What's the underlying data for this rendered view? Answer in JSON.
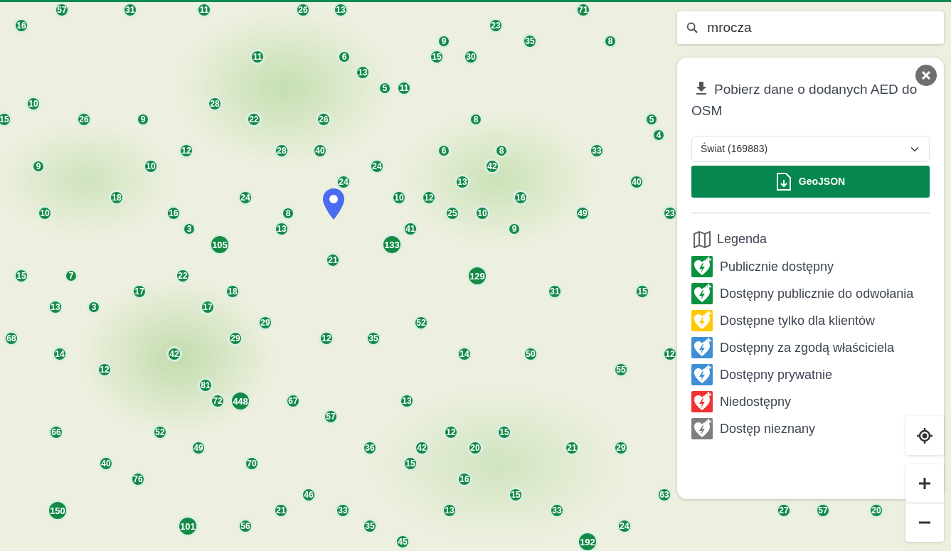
{
  "search": {
    "value": "mrocza"
  },
  "download_panel": {
    "title": "Pobierz dane o dodanych AED do OSM",
    "region_select": {
      "value": "Świat (169883)"
    },
    "button": "GeoJSON"
  },
  "legend": {
    "title": "Legenda",
    "items": [
      {
        "label": "Publicznie dostępny",
        "color": "#0a9140"
      },
      {
        "label": "Dostępny publicznie do odwołania",
        "color": "#0a9140"
      },
      {
        "label": "Dostępne tylko dla klientów",
        "color": "#ffc800"
      },
      {
        "label": "Dostępny za zgodą właściciela",
        "color": "#3f8fd6"
      },
      {
        "label": "Dostępny prywatnie",
        "color": "#3f8fd6"
      },
      {
        "label": "Niedostępny",
        "color": "#f03232"
      },
      {
        "label": "Dostęp nieznany",
        "color": "#7f7f7f"
      }
    ]
  },
  "clusters": [
    {
      "count": "57"
    },
    {
      "count": "31"
    },
    {
      "count": "11"
    },
    {
      "count": "26"
    },
    {
      "count": "13"
    },
    {
      "count": "71"
    },
    {
      "count": "16"
    },
    {
      "count": "23"
    },
    {
      "count": "9"
    },
    {
      "count": "35"
    },
    {
      "count": "8"
    },
    {
      "count": "11"
    },
    {
      "count": "6"
    },
    {
      "count": "15"
    },
    {
      "count": "30"
    },
    {
      "count": "13"
    },
    {
      "count": "5"
    },
    {
      "count": "11"
    },
    {
      "count": "10"
    },
    {
      "count": "28"
    },
    {
      "count": "15"
    },
    {
      "count": "26"
    },
    {
      "count": "9"
    },
    {
      "count": "22"
    },
    {
      "count": "26"
    },
    {
      "count": "8"
    },
    {
      "count": "5"
    },
    {
      "count": "4"
    },
    {
      "count": "12"
    },
    {
      "count": "28"
    },
    {
      "count": "40"
    },
    {
      "count": "6"
    },
    {
      "count": "8"
    },
    {
      "count": "33"
    },
    {
      "count": "9"
    },
    {
      "count": "10"
    },
    {
      "count": "24"
    },
    {
      "count": "42"
    },
    {
      "count": "24"
    },
    {
      "count": "13"
    },
    {
      "count": "40"
    },
    {
      "count": "18"
    },
    {
      "count": "24"
    },
    {
      "count": "10"
    },
    {
      "count": "12"
    },
    {
      "count": "16"
    },
    {
      "count": "10"
    },
    {
      "count": "16"
    },
    {
      "count": "8"
    },
    {
      "count": "25"
    },
    {
      "count": "10"
    },
    {
      "count": "49"
    },
    {
      "count": "23"
    },
    {
      "count": "3"
    },
    {
      "count": "13"
    },
    {
      "count": "41"
    },
    {
      "count": "9"
    },
    {
      "count": "105"
    },
    {
      "count": "133"
    },
    {
      "count": "21"
    },
    {
      "count": "15"
    },
    {
      "count": "7"
    },
    {
      "count": "22"
    },
    {
      "count": "129"
    },
    {
      "count": "17"
    },
    {
      "count": "18"
    },
    {
      "count": "31"
    },
    {
      "count": "15"
    },
    {
      "count": "13"
    },
    {
      "count": "3"
    },
    {
      "count": "17"
    },
    {
      "count": "29"
    },
    {
      "count": "52"
    },
    {
      "count": "68"
    },
    {
      "count": "29"
    },
    {
      "count": "12"
    },
    {
      "count": "35"
    },
    {
      "count": "14"
    },
    {
      "count": "42"
    },
    {
      "count": "14"
    },
    {
      "count": "50"
    },
    {
      "count": "12"
    },
    {
      "count": "12"
    },
    {
      "count": "55"
    },
    {
      "count": "81"
    },
    {
      "count": "72"
    },
    {
      "count": "448"
    },
    {
      "count": "67"
    },
    {
      "count": "13"
    },
    {
      "count": "57"
    },
    {
      "count": "66"
    },
    {
      "count": "52"
    },
    {
      "count": "12"
    },
    {
      "count": "15"
    },
    {
      "count": "49"
    },
    {
      "count": "36"
    },
    {
      "count": "42"
    },
    {
      "count": "20"
    },
    {
      "count": "21"
    },
    {
      "count": "29"
    },
    {
      "count": "40"
    },
    {
      "count": "70"
    },
    {
      "count": "15"
    },
    {
      "count": "76"
    },
    {
      "count": "16"
    },
    {
      "count": "46"
    },
    {
      "count": "15"
    },
    {
      "count": "63"
    },
    {
      "count": "150"
    },
    {
      "count": "21"
    },
    {
      "count": "33"
    },
    {
      "count": "13"
    },
    {
      "count": "33"
    },
    {
      "count": "27"
    },
    {
      "count": "57"
    },
    {
      "count": "20"
    },
    {
      "count": "101"
    },
    {
      "count": "56"
    },
    {
      "count": "35"
    },
    {
      "count": "24"
    },
    {
      "count": "45"
    },
    {
      "count": "192"
    }
  ]
}
